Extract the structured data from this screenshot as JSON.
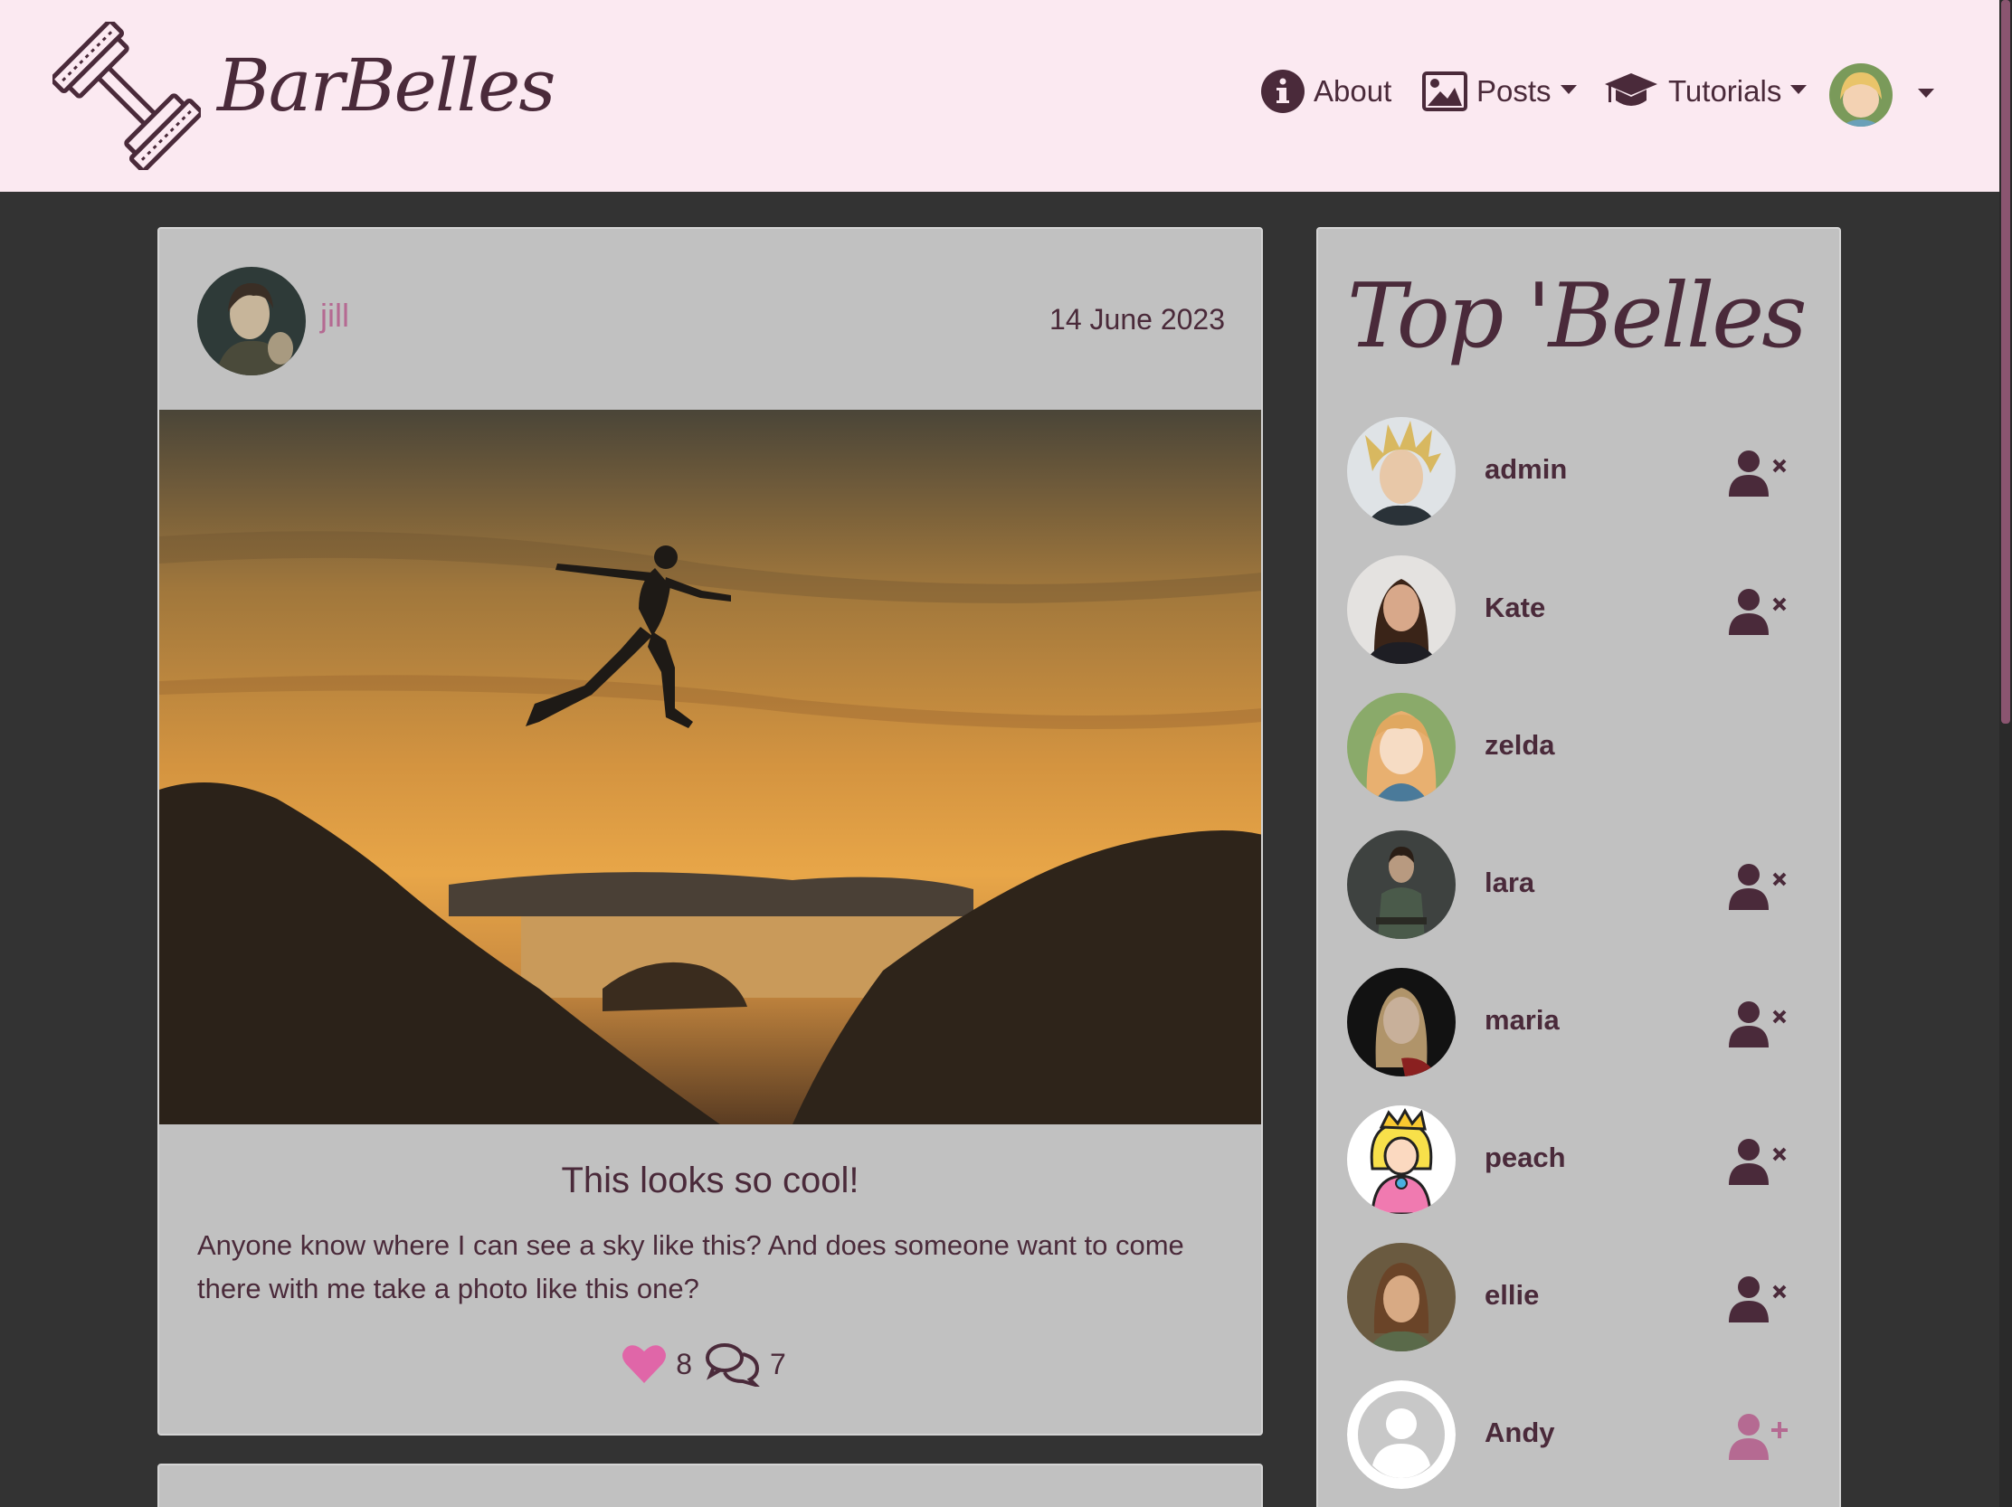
{
  "brand": {
    "name": "BarBelles",
    "logo_icon": "barbell-icon"
  },
  "nav": {
    "about": "About",
    "posts": "Posts",
    "tutorials": "Tutorials"
  },
  "post": {
    "author": "jill",
    "date": "14 June 2023",
    "title": "This looks so cool!",
    "body": "Anyone know where I can see a sky like this? And does someone want to come there with me take a photo like this one?",
    "likes": "8",
    "comments": "7"
  },
  "sidebar": {
    "title": "Top 'Belles",
    "belles": [
      {
        "name": "admin",
        "action": "unfollow"
      },
      {
        "name": "Kate",
        "action": "unfollow"
      },
      {
        "name": "zelda",
        "action": "none"
      },
      {
        "name": "lara",
        "action": "unfollow"
      },
      {
        "name": "maria",
        "action": "unfollow"
      },
      {
        "name": "peach",
        "action": "unfollow"
      },
      {
        "name": "ellie",
        "action": "unfollow"
      },
      {
        "name": "Andy",
        "action": "follow"
      }
    ]
  },
  "colors": {
    "navbar_bg": "#fbe9f1",
    "page_bg": "#333333",
    "card_bg": "#c1c1c1",
    "text": "#4a2a3a",
    "accent_pink": "#b56a92",
    "heart": "#e066a8"
  }
}
